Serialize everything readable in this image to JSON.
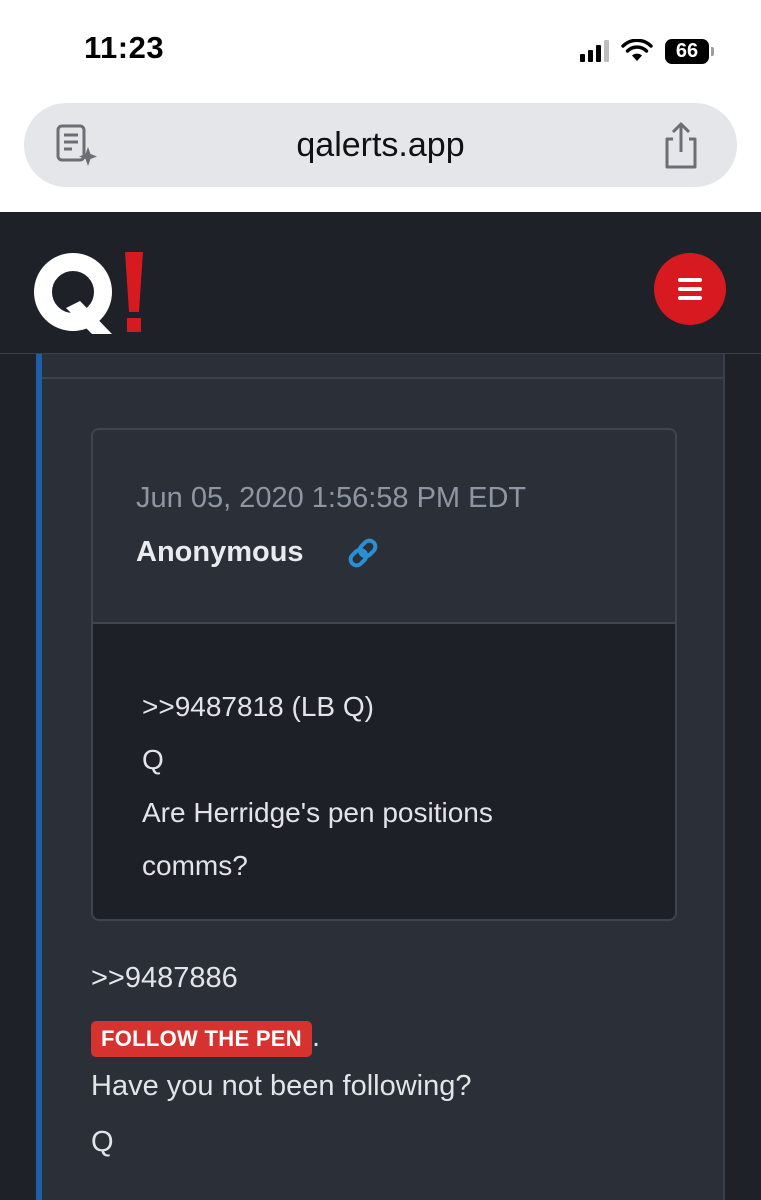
{
  "status_bar": {
    "time": "11:23",
    "battery": "66"
  },
  "browser": {
    "url": "qalerts.app",
    "left_icon": "reader-summary-icon",
    "right_icon": "share-icon"
  },
  "site_header": {
    "logo_text": "Q",
    "logo_accent": "!",
    "menu_icon": "hamburger-menu-icon"
  },
  "quoted_post": {
    "timestamp": "Jun 05, 2020 1:56:58 PM EDT",
    "author": "Anonymous",
    "link_icon": "link-icon",
    "lines": [
      ">>9487818 (LB Q)",
      "Q",
      "Are Herridge's pen positions",
      "comms?"
    ]
  },
  "post": {
    "reply_ref": ">>9487886",
    "highlight": "FOLLOW THE PEN",
    "highlight_suffix": ".",
    "lines": [
      "Have you not been following?",
      "Q"
    ]
  },
  "colors": {
    "accent_red": "#d71920",
    "accent_blue": "#1d5ea8",
    "link_blue": "#2a8fd4",
    "background": "#1e2128",
    "panel": "#2b2f38"
  }
}
